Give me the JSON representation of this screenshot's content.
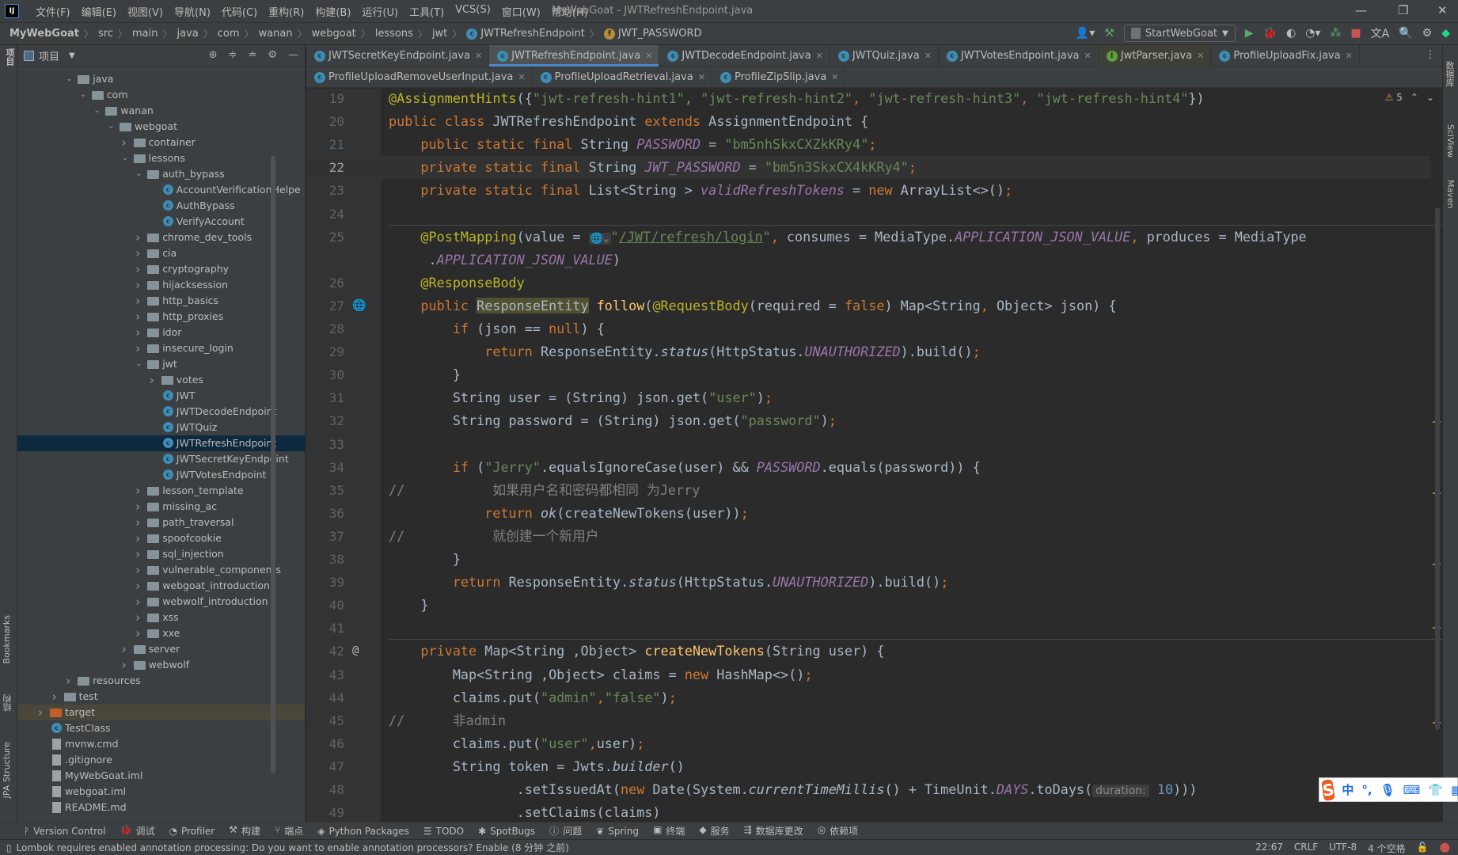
{
  "app": {
    "logo": "IJ",
    "window_title": "MyWebGoat - JWTRefreshEndpoint.java",
    "menu": [
      "文件(F)",
      "编辑(E)",
      "视图(V)",
      "导航(N)",
      "代码(C)",
      "重构(R)",
      "构建(B)",
      "运行(U)",
      "工具(T)",
      "VCS(S)",
      "窗口(W)",
      "帮助(H)"
    ]
  },
  "breadcrumb": [
    "MyWebGoat",
    "src",
    "main",
    "java",
    "com",
    "wanan",
    "webgoat",
    "lessons",
    "jwt",
    "JWTRefreshEndpoint",
    "JWT_PASSWORD"
  ],
  "run_config": "StartWebGoat",
  "left_strip": [
    "项目",
    "Bookmarks",
    "结构",
    "JPA Structure"
  ],
  "right_strip": [
    "数据库",
    "SciView",
    "Maven"
  ],
  "project": {
    "title": "项目",
    "tree": [
      {
        "label": "java",
        "level": 2,
        "type": "folder",
        "arrow": "open"
      },
      {
        "label": "com",
        "level": 3,
        "type": "folder",
        "arrow": "open"
      },
      {
        "label": "wanan",
        "level": 4,
        "type": "folder",
        "arrow": "open"
      },
      {
        "label": "webgoat",
        "level": 5,
        "type": "folder",
        "arrow": "open"
      },
      {
        "label": "container",
        "level": 6,
        "type": "folder",
        "arrow": "closed"
      },
      {
        "label": "lessons",
        "level": 6,
        "type": "folder",
        "arrow": "open"
      },
      {
        "label": "auth_bypass",
        "level": 7,
        "type": "folder",
        "arrow": "open"
      },
      {
        "label": "AccountVerificationHelpe",
        "level": 8,
        "type": "class"
      },
      {
        "label": "AuthBypass",
        "level": 8,
        "type": "class"
      },
      {
        "label": "VerifyAccount",
        "level": 8,
        "type": "class"
      },
      {
        "label": "chrome_dev_tools",
        "level": 7,
        "type": "folder",
        "arrow": "closed"
      },
      {
        "label": "cia",
        "level": 7,
        "type": "folder",
        "arrow": "closed"
      },
      {
        "label": "cryptography",
        "level": 7,
        "type": "folder",
        "arrow": "closed"
      },
      {
        "label": "hijacksession",
        "level": 7,
        "type": "folder",
        "arrow": "closed"
      },
      {
        "label": "http_basics",
        "level": 7,
        "type": "folder",
        "arrow": "closed"
      },
      {
        "label": "http_proxies",
        "level": 7,
        "type": "folder",
        "arrow": "closed"
      },
      {
        "label": "idor",
        "level": 7,
        "type": "folder",
        "arrow": "closed"
      },
      {
        "label": "insecure_login",
        "level": 7,
        "type": "folder",
        "arrow": "closed"
      },
      {
        "label": "jwt",
        "level": 7,
        "type": "folder",
        "arrow": "open"
      },
      {
        "label": "votes",
        "level": 8,
        "type": "folder",
        "arrow": "closed"
      },
      {
        "label": "JWT",
        "level": 8,
        "type": "class"
      },
      {
        "label": "JWTDecodeEndpoint",
        "level": 8,
        "type": "class"
      },
      {
        "label": "JWTQuiz",
        "level": 8,
        "type": "class"
      },
      {
        "label": "JWTRefreshEndpoint",
        "level": 8,
        "type": "class",
        "selected": true
      },
      {
        "label": "JWTSecretKeyEndpoint",
        "level": 8,
        "type": "class"
      },
      {
        "label": "JWTVotesEndpoint",
        "level": 8,
        "type": "class"
      },
      {
        "label": "lesson_template",
        "level": 7,
        "type": "folder",
        "arrow": "closed"
      },
      {
        "label": "missing_ac",
        "level": 7,
        "type": "folder",
        "arrow": "closed"
      },
      {
        "label": "path_traversal",
        "level": 7,
        "type": "folder",
        "arrow": "closed"
      },
      {
        "label": "spoofcookie",
        "level": 7,
        "type": "folder",
        "arrow": "closed"
      },
      {
        "label": "sql_injection",
        "level": 7,
        "type": "folder",
        "arrow": "closed"
      },
      {
        "label": "vulnerable_components",
        "level": 7,
        "type": "folder",
        "arrow": "closed"
      },
      {
        "label": "webgoat_introduction",
        "level": 7,
        "type": "folder",
        "arrow": "closed"
      },
      {
        "label": "webwolf_introduction",
        "level": 7,
        "type": "folder",
        "arrow": "closed"
      },
      {
        "label": "xss",
        "level": 7,
        "type": "folder",
        "arrow": "closed"
      },
      {
        "label": "xxe",
        "level": 7,
        "type": "folder",
        "arrow": "closed"
      },
      {
        "label": "server",
        "level": 6,
        "type": "folder",
        "arrow": "closed"
      },
      {
        "label": "webwolf",
        "level": 6,
        "type": "folder",
        "arrow": "closed"
      },
      {
        "label": "resources",
        "level": 2,
        "type": "folder",
        "arrow": "closed"
      },
      {
        "label": "test",
        "level": 1,
        "type": "folder",
        "arrow": "closed"
      },
      {
        "label": "target",
        "level": 0,
        "type": "folder-orange",
        "arrow": "closed",
        "highlight": true
      },
      {
        "label": "TestClass",
        "level": 0,
        "type": "class"
      },
      {
        "label": "mvnw.cmd",
        "level": 0,
        "type": "file"
      },
      {
        "label": ".gitignore",
        "level": 0,
        "type": "file"
      },
      {
        "label": "MyWebGoat.iml",
        "level": 0,
        "type": "file"
      },
      {
        "label": "webgoat.iml",
        "level": 0,
        "type": "file"
      },
      {
        "label": "README.md",
        "level": 0,
        "type": "file"
      }
    ]
  },
  "tabs_row1": [
    {
      "label": "JWTSecretKeyEndpoint.java",
      "icon": "c"
    },
    {
      "label": "JWTRefreshEndpoint.java",
      "icon": "c",
      "active": true
    },
    {
      "label": "JWTDecodeEndpoint.java",
      "icon": "c"
    },
    {
      "label": "JWTQuiz.java",
      "icon": "c"
    },
    {
      "label": "JWTVotesEndpoint.java",
      "icon": "c"
    },
    {
      "label": "JwtParser.java",
      "icon": "i"
    },
    {
      "label": "ProfileUploadFix.java",
      "icon": "c"
    }
  ],
  "tabs_row2": [
    {
      "label": "ProfileUploadRemoveUserInput.java",
      "icon": "c"
    },
    {
      "label": "ProfileUploadRetrieval.java",
      "icon": "c"
    },
    {
      "label": "ProfileZipSlip.java",
      "icon": "c"
    }
  ],
  "editor": {
    "warnings": "5",
    "current_line": 22,
    "lines": [
      {
        "n": "19",
        "t": [
          [
            "a",
            "@AssignmentHints"
          ],
          [
            "p",
            "({"
          ],
          [
            "s",
            "\"jwt-refresh-hint1\""
          ],
          [
            "k",
            ", "
          ],
          [
            "s",
            "\"jwt-refresh-hint2\""
          ],
          [
            "k",
            ", "
          ],
          [
            "s",
            "\"jwt-refresh-hint3\""
          ],
          [
            "k",
            ", "
          ],
          [
            "s",
            "\"jwt-refresh-hint4\""
          ],
          [
            "p",
            "})"
          ]
        ]
      },
      {
        "n": "20",
        "t": [
          [
            "k",
            "public class "
          ],
          [
            "p",
            "JWTRefreshEndpoint "
          ],
          [
            "k",
            "extends "
          ],
          [
            "p",
            "AssignmentEndpoint {"
          ]
        ]
      },
      {
        "n": "21",
        "t": [
          [
            "k",
            "    public static final "
          ],
          [
            "p",
            "String "
          ],
          [
            "f",
            "PASSWORD"
          ],
          [
            "p",
            " = "
          ],
          [
            "s",
            "\"bm5nhSkxCXZkKRy4\""
          ],
          [
            "k",
            ";"
          ]
        ]
      },
      {
        "n": "22",
        "t": [
          [
            "k",
            "    private static final "
          ],
          [
            "p",
            "String "
          ],
          [
            "f",
            "JWT_PASSWORD"
          ],
          [
            "p",
            " = "
          ],
          [
            "s",
            "\"bm5n3SkxCX4kKRy4\""
          ],
          [
            "k",
            ";"
          ]
        ]
      },
      {
        "n": "23",
        "t": [
          [
            "k",
            "    private static final "
          ],
          [
            "p",
            "List<String > "
          ],
          [
            "f",
            "validRefreshTokens"
          ],
          [
            "p",
            " = "
          ],
          [
            "k",
            "new "
          ],
          [
            "p",
            "ArrayList<>()"
          ],
          [
            "k",
            ";"
          ]
        ]
      },
      {
        "n": "24",
        "t": []
      },
      {
        "n": "25",
        "sep": true,
        "t": [
          [
            "a",
            "    @PostMapping"
          ],
          [
            "p",
            "(value = "
          ],
          [
            "g",
            "🌐⌄"
          ],
          [
            "s",
            "\""
          ],
          [
            "u",
            "/JWT/refresh/login"
          ],
          [
            "s",
            "\""
          ],
          [
            "k",
            ", "
          ],
          [
            "p",
            "consumes = MediaType."
          ],
          [
            "f",
            "APPLICATION_JSON_VALUE"
          ],
          [
            "k",
            ", "
          ],
          [
            "p",
            "produces = MediaType"
          ]
        ]
      },
      {
        "n": "",
        "t": [
          [
            "p",
            "     ."
          ],
          [
            "f",
            "APPLICATION_JSON_VALUE"
          ],
          [
            "p",
            ")"
          ]
        ]
      },
      {
        "n": "26",
        "t": [
          [
            "a",
            "    @ResponseBody"
          ]
        ]
      },
      {
        "n": "27",
        "gicon": "globe",
        "t": [
          [
            "k",
            "    public "
          ],
          [
            "hl",
            "ResponseEntity"
          ],
          [
            "m",
            " follow"
          ],
          [
            "p",
            "("
          ],
          [
            "a",
            "@RequestBody"
          ],
          [
            "p",
            "(required = "
          ],
          [
            "k",
            "false"
          ],
          [
            "p",
            ") Map<String"
          ],
          [
            "k",
            ", "
          ],
          [
            "p",
            "Object> json) {"
          ]
        ]
      },
      {
        "n": "28",
        "t": [
          [
            "k",
            "        if "
          ],
          [
            "p",
            "(json == "
          ],
          [
            "k",
            "null"
          ],
          [
            "p",
            ") {"
          ]
        ]
      },
      {
        "n": "29",
        "t": [
          [
            "k",
            "            return "
          ],
          [
            "p",
            "ResponseEntity."
          ],
          [
            "i",
            "status"
          ],
          [
            "p",
            "(HttpStatus."
          ],
          [
            "f",
            "UNAUTHORIZED"
          ],
          [
            "p",
            ").build()"
          ],
          [
            "k",
            ";"
          ]
        ]
      },
      {
        "n": "30",
        "t": [
          [
            "p",
            "        }"
          ]
        ]
      },
      {
        "n": "31",
        "t": [
          [
            "p",
            "        String user = (String) json.get("
          ],
          [
            "s",
            "\"user\""
          ],
          [
            "p",
            ")"
          ],
          [
            "k",
            ";"
          ]
        ]
      },
      {
        "n": "32",
        "t": [
          [
            "p",
            "        String password = (String) json.get("
          ],
          [
            "s",
            "\"password\""
          ],
          [
            "p",
            ")"
          ],
          [
            "k",
            ";"
          ]
        ]
      },
      {
        "n": "33",
        "t": []
      },
      {
        "n": "34",
        "t": [
          [
            "k",
            "        if "
          ],
          [
            "p",
            "("
          ],
          [
            "s",
            "\"Jerry\""
          ],
          [
            "p",
            ".equalsIgnoreCase(user) && "
          ],
          [
            "f",
            "PASSWORD"
          ],
          [
            "p",
            ".equals(password)) {"
          ]
        ]
      },
      {
        "n": "35",
        "t": [
          [
            "c",
            "//           如果用户名和密码都相同 为Jerry"
          ]
        ]
      },
      {
        "n": "36",
        "t": [
          [
            "k",
            "            return "
          ],
          [
            "i",
            "ok"
          ],
          [
            "p",
            "(createNewTokens(user))"
          ],
          [
            "k",
            ";"
          ]
        ]
      },
      {
        "n": "37",
        "t": [
          [
            "c",
            "//           就创建一个新用户"
          ]
        ]
      },
      {
        "n": "38",
        "t": [
          [
            "p",
            "        }"
          ]
        ]
      },
      {
        "n": "39",
        "t": [
          [
            "k",
            "        return "
          ],
          [
            "p",
            "ResponseEntity."
          ],
          [
            "i",
            "status"
          ],
          [
            "p",
            "(HttpStatus."
          ],
          [
            "f",
            "UNAUTHORIZED"
          ],
          [
            "p",
            ").build()"
          ],
          [
            "k",
            ";"
          ]
        ]
      },
      {
        "n": "40",
        "t": [
          [
            "p",
            "    }"
          ]
        ]
      },
      {
        "n": "41",
        "t": []
      },
      {
        "n": "42",
        "sep": true,
        "gicon": "at",
        "t": [
          [
            "k",
            "    private "
          ],
          [
            "p",
            "Map<String ,Object> "
          ],
          [
            "m",
            "createNewTokens"
          ],
          [
            "p",
            "(String user) {"
          ]
        ]
      },
      {
        "n": "43",
        "t": [
          [
            "p",
            "        Map<String ,Object> claims = "
          ],
          [
            "k",
            "new "
          ],
          [
            "p",
            "HashMap<>()"
          ],
          [
            "k",
            ";"
          ]
        ]
      },
      {
        "n": "44",
        "t": [
          [
            "p",
            "        claims.put("
          ],
          [
            "s",
            "\"admin\""
          ],
          [
            "k",
            ","
          ],
          [
            "s",
            "\"false\""
          ],
          [
            "p",
            ")"
          ],
          [
            "k",
            ";"
          ]
        ]
      },
      {
        "n": "45",
        "t": [
          [
            "c",
            "//      非admin"
          ]
        ]
      },
      {
        "n": "46",
        "t": [
          [
            "p",
            "        claims.put("
          ],
          [
            "s",
            "\"user\""
          ],
          [
            "k",
            ","
          ],
          [
            "p",
            "user)"
          ],
          [
            "k",
            ";"
          ]
        ]
      },
      {
        "n": "47",
        "t": [
          [
            "p",
            "        String token = Jwts."
          ],
          [
            "i",
            "builder"
          ],
          [
            "p",
            "()"
          ]
        ]
      },
      {
        "n": "48",
        "t": [
          [
            "p",
            "                .setIssuedAt("
          ],
          [
            "k",
            "new "
          ],
          [
            "p",
            "Date(System."
          ],
          [
            "i",
            "currentTimeMillis"
          ],
          [
            "p",
            "() + TimeUnit."
          ],
          [
            "f",
            "DAYS"
          ],
          [
            "p",
            ".toDays("
          ],
          [
            "h",
            "duration:"
          ],
          [
            "n",
            " 10"
          ],
          [
            "p",
            ")))"
          ]
        ]
      },
      {
        "n": "49",
        "t": [
          [
            "p",
            "                .setClaims(claims)"
          ]
        ]
      }
    ]
  },
  "bottom_tools": [
    "Version Control",
    "调试",
    "Profiler",
    "构建",
    "端点",
    "Python Packages",
    "TODO",
    "SpotBugs",
    "问题",
    "Spring",
    "终端",
    "服务",
    "数据库更改",
    "依赖项"
  ],
  "status": {
    "message": "Lombok requires enabled annotation processing: Do you want to enable annotation processors? Enable (8 分钟 之前)",
    "position": "22:67",
    "line_ending": "CRLF",
    "encoding": "UTF-8",
    "indent": "4 个空格"
  },
  "ime": {
    "mode": "中",
    "punct": "°,"
  },
  "colors": {
    "keyword": "#cc7832",
    "string": "#6a8759",
    "annotation": "#bbb529",
    "field": "#9876aa",
    "comment": "#808080",
    "accent": "#4a88c7",
    "editor_bg": "#2b2b2b",
    "panel_bg": "#3c3f41"
  }
}
